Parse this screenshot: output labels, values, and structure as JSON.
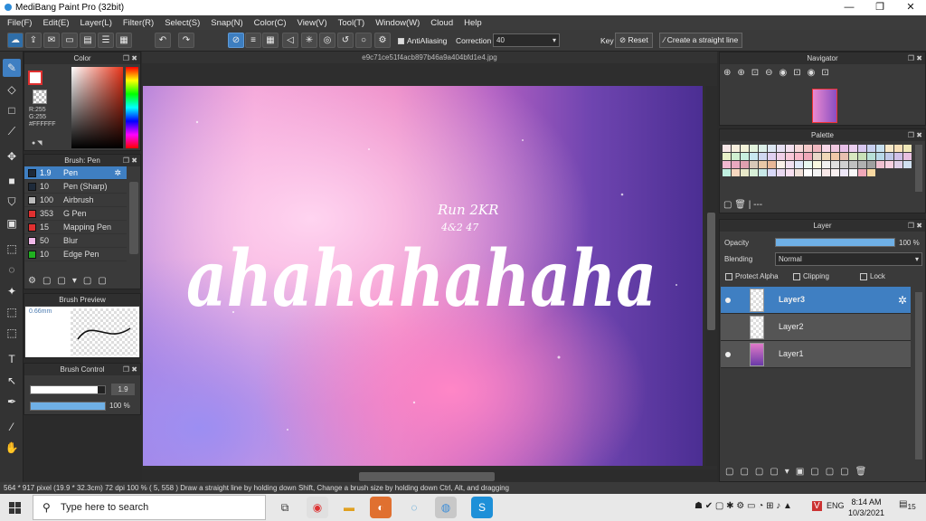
{
  "window": {
    "title": "MediBang Paint Pro (32bit)",
    "controls": [
      "—",
      "❐",
      "✕"
    ]
  },
  "menu": [
    "File(F)",
    "Edit(E)",
    "Layer(L)",
    "Filter(R)",
    "Select(S)",
    "Snap(N)",
    "Color(C)",
    "View(V)",
    "Tool(T)",
    "Window(W)",
    "Cloud",
    "Help"
  ],
  "toolbar": {
    "antialiasing_label": "AntiAliasing",
    "correction_label": "Correction",
    "correction_value": "40",
    "key_label": "Key",
    "reset_label": "Reset",
    "straight_line_label": "Create a straight line"
  },
  "color_panel": {
    "title": "Color",
    "r": "R:255",
    "g": "G:255",
    "hex": "#FFFFFF"
  },
  "brush_panel": {
    "title": "Brush: Pen",
    "items": [
      {
        "size": "1.9",
        "name": "Pen",
        "color": "#1e2a3a"
      },
      {
        "size": "10",
        "name": "Pen (Sharp)",
        "color": "#1e2a3a"
      },
      {
        "size": "100",
        "name": "Airbrush",
        "color": "#bbbbbb"
      },
      {
        "size": "353",
        "name": "G Pen",
        "color": "#e03030"
      },
      {
        "size": "15",
        "name": "Mapping Pen",
        "color": "#e03030"
      },
      {
        "size": "50",
        "name": "Blur",
        "color": "#f0b8e8"
      },
      {
        "size": "10",
        "name": "Edge Pen",
        "color": "#20b020"
      }
    ]
  },
  "brush_preview": {
    "title": "Brush Preview",
    "size": "0.66mm"
  },
  "brush_control": {
    "title": "Brush Control",
    "size_value": "1.9",
    "size_fraction": 0.9,
    "opacity_value": "100 %",
    "opacity_fraction": 1.0
  },
  "canvas": {
    "filename": "e9c71ce51f4acb897b46a9a404bfd1e4.jpg",
    "main_text": "ahahahahaha",
    "signature_line1": "Run 2KR",
    "signature_line2": "4&2 47"
  },
  "navigator": {
    "title": "Navigator"
  },
  "palette": {
    "title": "Palette",
    "extra": "---",
    "colors": [
      "#f6e6e6",
      "#f7eedc",
      "#f2f2d8",
      "#e2f2dc",
      "#dcefe8",
      "#dce6f2",
      "#e6e0f2",
      "#f2e0ee",
      "#f6d8d8",
      "#f4c8c8",
      "#f0b8c0",
      "#f8d8e8",
      "#f0c8e0",
      "#e8c0e8",
      "#ecd0f0",
      "#d8c8f0",
      "#c8d0f0",
      "#c8e0f0",
      "#f8e8c8",
      "#f8e0b8",
      "#f0e8b8",
      "#e8f0c8",
      "#d0f0d0",
      "#c8f0e0",
      "#c8e8f0",
      "#d0d8f0",
      "#e0d0f0",
      "#f0d0e8",
      "#f8c8d8",
      "#f8b8c8",
      "#f0a8b8",
      "#e8d8c8",
      "#f0d8b8",
      "#f0c8a8",
      "#e8c0b0",
      "#d8e8c0",
      "#c8e0b8",
      "#b8e0d8",
      "#b8d8e8",
      "#c0c8e8",
      "#d0c0e8",
      "#e8c0e0",
      "#f0b8d0",
      "#e8a8c0",
      "#e0a0b0",
      "#d8c8b8",
      "#e8c8a8",
      "#e8b898",
      "#f8f0e8",
      "#f0e0f0",
      "#e0e8f8",
      "#e8f8f0",
      "#f8f8e0",
      "#f0f0f0",
      "#e0e0e0",
      "#d0d0d0",
      "#c0c0c0",
      "#b0b0b0",
      "#a0a0a0",
      "#f0c0d0",
      "#f8d0e0",
      "#e0d0e8",
      "#d0e0f0",
      "#c0f0e0",
      "#f8d8c0",
      "#e8e8c8",
      "#d8f0d8",
      "#c8e8e8",
      "#d8d8f8",
      "#e8d8f0",
      "#f8e0f0",
      "#f0e0d8",
      "#ffffff",
      "#f4f4f4",
      "#f8e8e8",
      "#f8f0f0",
      "#eee8f8",
      "#f8f8f8",
      "#f0a8b8",
      "#f8d8a0"
    ]
  },
  "layer_panel": {
    "title": "Layer",
    "opacity_label": "Opacity",
    "opacity_value": "100 %",
    "opacity_fraction": 1.0,
    "blending_label": "Blending",
    "blending_value": "Normal",
    "protect_alpha": "Protect Alpha",
    "clipping": "Clipping",
    "lock": "Lock",
    "layers": [
      {
        "name": "Layer3",
        "visible": true,
        "selected": true
      },
      {
        "name": "Layer2",
        "visible": false,
        "selected": false
      },
      {
        "name": "Layer1",
        "visible": true,
        "selected": false
      }
    ]
  },
  "status": {
    "text": "564 * 917 pixel  (19.9 * 32.3cm)  72 dpi  100 %  ( 5, 558 )  Draw a straight line by holding down Shift, Change a brush size by holding down Ctrl, Alt, and dragging"
  },
  "taskbar": {
    "search_placeholder": "Type here to search",
    "lang": "ENG",
    "time": "8:14 AM",
    "date": "10/3/2021",
    "notifications": "15"
  }
}
